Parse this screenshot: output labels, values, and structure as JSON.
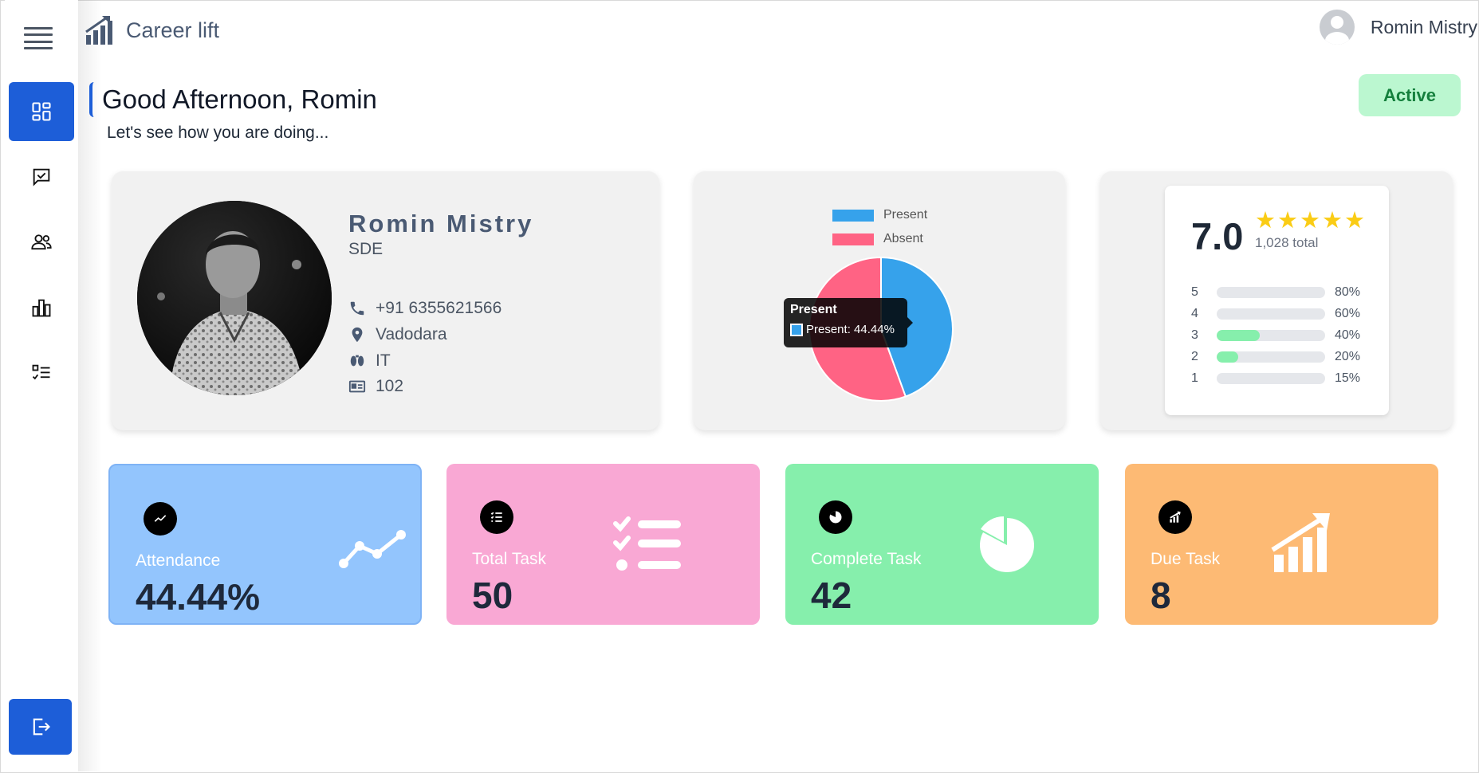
{
  "app": {
    "title": "Career lift",
    "icon": "chart-growth-icon"
  },
  "header": {
    "user_name": "Romin Mistry"
  },
  "sidebar": {
    "items": [
      {
        "name": "dashboard",
        "icon": "dashboard-grid-icon",
        "active": true
      },
      {
        "name": "tasks",
        "icon": "task-check-icon",
        "active": false
      },
      {
        "name": "team",
        "icon": "users-icon",
        "active": false
      },
      {
        "name": "reports",
        "icon": "bar-chart-icon",
        "active": false
      },
      {
        "name": "checklist",
        "icon": "checklist-icon",
        "active": false
      }
    ],
    "logout_icon": "logout-icon"
  },
  "greeting": {
    "title": "Good Afternoon, Romin",
    "subtitle": "Let's see how you are doing..."
  },
  "status": "Active",
  "profile": {
    "name": "Romin Mistry",
    "role": "SDE",
    "phone": "+91 6355621566",
    "location": "Vadodara",
    "department": "IT",
    "employee_id": "102"
  },
  "chart_data": {
    "type": "pie",
    "categories": [
      "Present",
      "Absent"
    ],
    "values": [
      44.44,
      55.56
    ],
    "colors": [
      "#36a2eb",
      "#ff6384"
    ],
    "legend_position": "top",
    "tooltip": {
      "title": "Present",
      "text": "Present: 44.44%"
    }
  },
  "rating": {
    "score": "7.0",
    "stars": 5,
    "total": "1,028 total",
    "breakdown": [
      {
        "label": "5",
        "percent": "80%",
        "fill": 0.0
      },
      {
        "label": "4",
        "percent": "60%",
        "fill": 0.0
      },
      {
        "label": "3",
        "percent": "40%",
        "fill": 0.4
      },
      {
        "label": "2",
        "percent": "20%",
        "fill": 0.2
      },
      {
        "label": "1",
        "percent": "15%",
        "fill": 0.0
      }
    ]
  },
  "stats": [
    {
      "label": "Attendance",
      "value": "44.44%",
      "color": "#93c5fd",
      "icon": "trend-line-icon"
    },
    {
      "label": "Total Task",
      "value": "50",
      "color": "#f9a8d4",
      "icon": "task-list-icon"
    },
    {
      "label": "Complete Task",
      "value": "42",
      "color": "#86efac",
      "icon": "pie-progress-icon"
    },
    {
      "label": "Due Task",
      "value": "8",
      "color": "#fdba74",
      "icon": "growth-bars-icon"
    }
  ]
}
